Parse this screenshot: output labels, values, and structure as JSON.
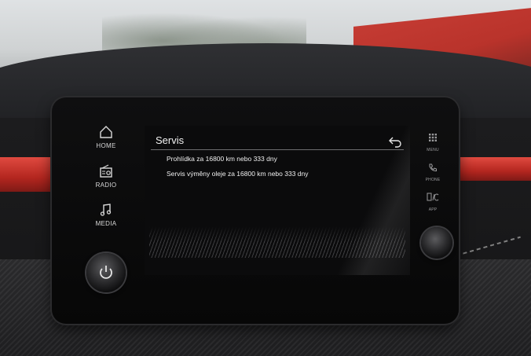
{
  "side_menu": {
    "items": [
      {
        "icon": "home-icon",
        "label": "HOME"
      },
      {
        "icon": "radio-icon",
        "label": "RADIO"
      },
      {
        "icon": "music-note-icon",
        "label": "MEDIA"
      }
    ]
  },
  "screen": {
    "title": "Servis",
    "messages": [
      "Prohlídka za 16800 km nebo 333 dny",
      "Servis výměny oleje za 16800 km nebo 333 dny"
    ]
  },
  "right_menu": {
    "items": [
      {
        "icon": "grid-icon",
        "label": "MENU"
      },
      {
        "icon": "phone-icon",
        "label": "PHONE"
      },
      {
        "icon": "app-icon",
        "label": "APP"
      }
    ]
  },
  "colors": {
    "trim_red": "#c0302a",
    "screen_bg": "#0b0b0c"
  }
}
